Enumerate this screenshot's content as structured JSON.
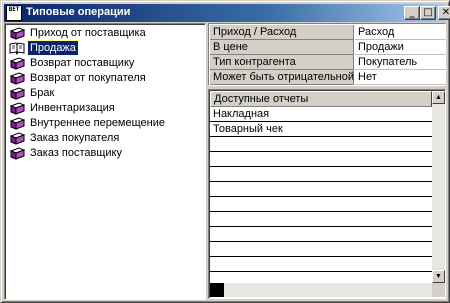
{
  "window": {
    "title": "Типовые операции",
    "app_icon_text": "ВЕТ",
    "buttons": {
      "minimize": "_",
      "maximize": "□",
      "close": "✕"
    }
  },
  "operations": [
    {
      "label": "Приход от поставщика",
      "icon": "book-icon",
      "selected": false
    },
    {
      "label": "Продажа",
      "icon": "open-book-icon",
      "selected": true
    },
    {
      "label": "Возврат поставщику",
      "icon": "book-icon",
      "selected": false
    },
    {
      "label": "Возврат от покупателя",
      "icon": "book-icon",
      "selected": false
    },
    {
      "label": "Брак",
      "icon": "book-icon",
      "selected": false
    },
    {
      "label": "Инвентаризация",
      "icon": "book-icon",
      "selected": false
    },
    {
      "label": "Внутреннее перемещение",
      "icon": "book-icon",
      "selected": false
    },
    {
      "label": "Заказ покупателя",
      "icon": "book-icon",
      "selected": false
    },
    {
      "label": "Заказ поставщику",
      "icon": "book-icon",
      "selected": false
    }
  ],
  "properties": [
    {
      "key": "Приход / Расход",
      "value": "Расход"
    },
    {
      "key": "В цене",
      "value": "Продажи"
    },
    {
      "key": "Тип контрагента",
      "value": "Покупатель"
    },
    {
      "key": "Может быть отрицательной",
      "value": "Нет"
    }
  ],
  "reports": {
    "header": "Доступные отчеты",
    "items": [
      "Накладная",
      "Товарный чек",
      "",
      "",
      "",
      "",
      "",
      "",
      "",
      "",
      ""
    ]
  },
  "scrollbar": {
    "up": "▲",
    "down": "▼"
  },
  "colors": {
    "face": "#d4d0c8",
    "title_start": "#0a246a",
    "title_end": "#a6caf0",
    "selection": "#0a246a",
    "book": "#7a1b8c"
  }
}
